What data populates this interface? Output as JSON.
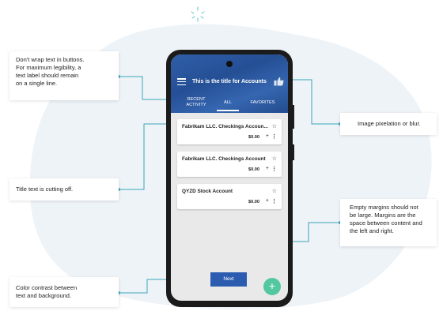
{
  "callouts": {
    "wrap_text": "Don't wrap text in buttons.\nFor  maximum legibility, a\ntext label  should remain\non a single line.",
    "title_cutoff": "Title text is cutting off.",
    "contrast": "Color contrast between\ntext  and background.",
    "image_pixelation": "Image pixelation or blur.",
    "margins": "Empty margins should not\nbe large.  Margins are the\nspace between content  and\nthe left and right."
  },
  "app": {
    "title": "This is the title for Accounts",
    "tabs": [
      {
        "label": "RECENT\nACTIVITY"
      },
      {
        "label": "ALL"
      },
      {
        "label": "FAVORITES"
      }
    ],
    "active_tab": "ALL",
    "accounts": [
      {
        "name": "Fabrikam LLC. Checkings Accoun...",
        "amount": "$0.00"
      },
      {
        "name": "Fabrikam LLC. Checkings Account",
        "amount": "$0.00"
      },
      {
        "name": "QYZD Stock Account",
        "amount": "$0.00"
      }
    ],
    "next_label": "Next",
    "fab_label": "+",
    "star_glyph": "☆",
    "plus_glyph": "+",
    "more_glyph": "⋮"
  },
  "colors": {
    "appbar": "#2b5aa6",
    "next_button": "#2b5cb0",
    "fab": "#52c7a0",
    "connector": "#3aa6b9"
  },
  "icons": {
    "menu": "hamburger-icon",
    "thumb": "thumbs-up-icon",
    "star": "star-outline-icon",
    "add": "plus-icon",
    "more": "more-vertical-icon",
    "spark": "sparkle-icon"
  }
}
